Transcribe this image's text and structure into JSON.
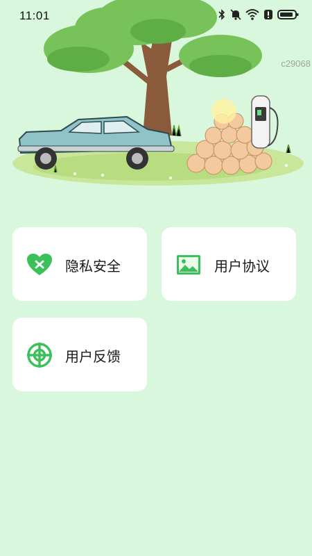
{
  "status_bar": {
    "time": "11:01",
    "icons": [
      "bluetooth-icon",
      "mute-bell-icon",
      "wifi-icon",
      "alert-icon",
      "battery-icon"
    ]
  },
  "watermark": "c29068",
  "hero": {
    "illustration": "tree-car-charger-illustration"
  },
  "menu": {
    "privacy_label": "隐私安全",
    "agreement_label": "用户协议",
    "feedback_label": "用户反馈"
  },
  "colors": {
    "background": "#d9f7dc",
    "accent": "#3cc15a",
    "card": "#ffffff"
  }
}
